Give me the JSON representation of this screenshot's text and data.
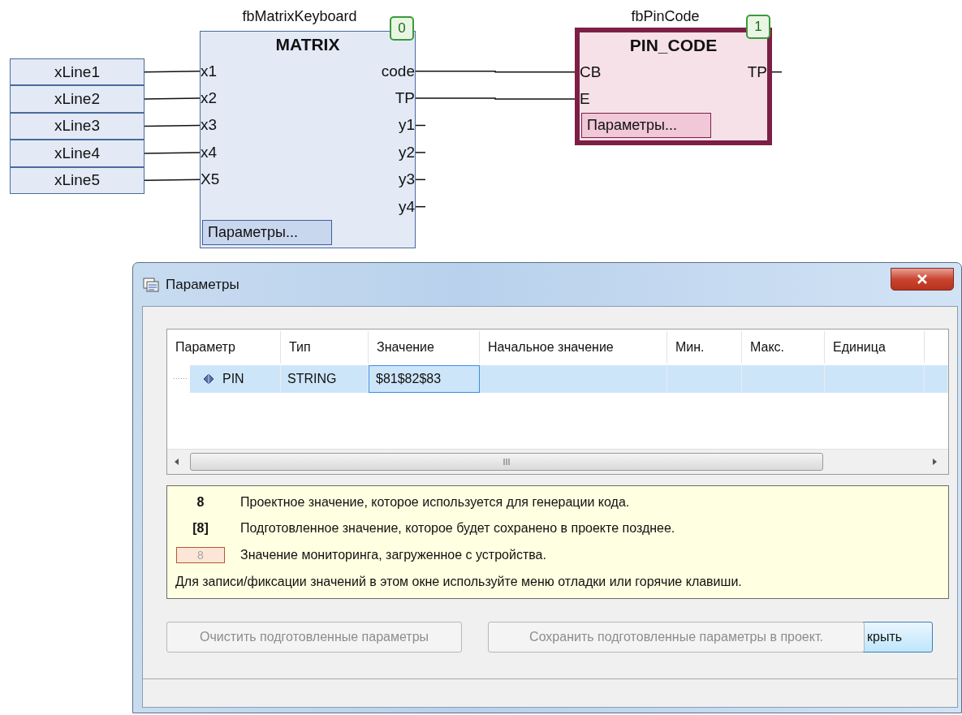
{
  "diagram": {
    "variables": [
      "xLine1",
      "xLine2",
      "xLine3",
      "xLine4",
      "xLine5"
    ],
    "blocks": [
      {
        "instance": "fbMatrixKeyboard",
        "type": "MATRIX",
        "order": "0",
        "selected": false,
        "inputs": [
          "x1",
          "x2",
          "x3",
          "x4",
          "X5"
        ],
        "outputs": [
          "code",
          "TP",
          "y1",
          "y2",
          "y3",
          "y4"
        ],
        "params_button": "Параметры..."
      },
      {
        "instance": "fbPinCode",
        "type": "PIN_CODE",
        "order": "1",
        "selected": true,
        "inputs": [
          "CB",
          "E"
        ],
        "outputs": [
          "TP"
        ],
        "params_button": "Параметры..."
      }
    ]
  },
  "dialog": {
    "title": "Параметры",
    "table": {
      "columns": [
        "Параметр",
        "Тип",
        "Значение",
        "Начальное значение",
        "Мин.",
        "Макс.",
        "Единица"
      ],
      "rows": [
        {
          "parameter": "PIN",
          "type": "STRING",
          "value": "$81$82$83",
          "selected": true
        }
      ]
    },
    "legend": {
      "items": [
        {
          "kind": "project",
          "sample": "8",
          "text": "Проектное значение, которое используется для генерации кода."
        },
        {
          "kind": "prepared",
          "sample": "[8]",
          "text": "Подготовленное значение, которое будет сохранено в проекте позднее."
        },
        {
          "kind": "monitoring",
          "sample": "8",
          "text": "Значение мониторинга, загруженное с устройства."
        }
      ],
      "note": "Для записи/фиксации значений в этом окне используйте меню отладки или горячие клавиши."
    },
    "buttons": [
      {
        "label": "Очистить подготовленные параметры",
        "disabled": true
      },
      {
        "label": "Сохранить подготовленные параметры в проект.",
        "disabled": true
      },
      {
        "label": "крыть",
        "disabled": false
      }
    ]
  }
}
